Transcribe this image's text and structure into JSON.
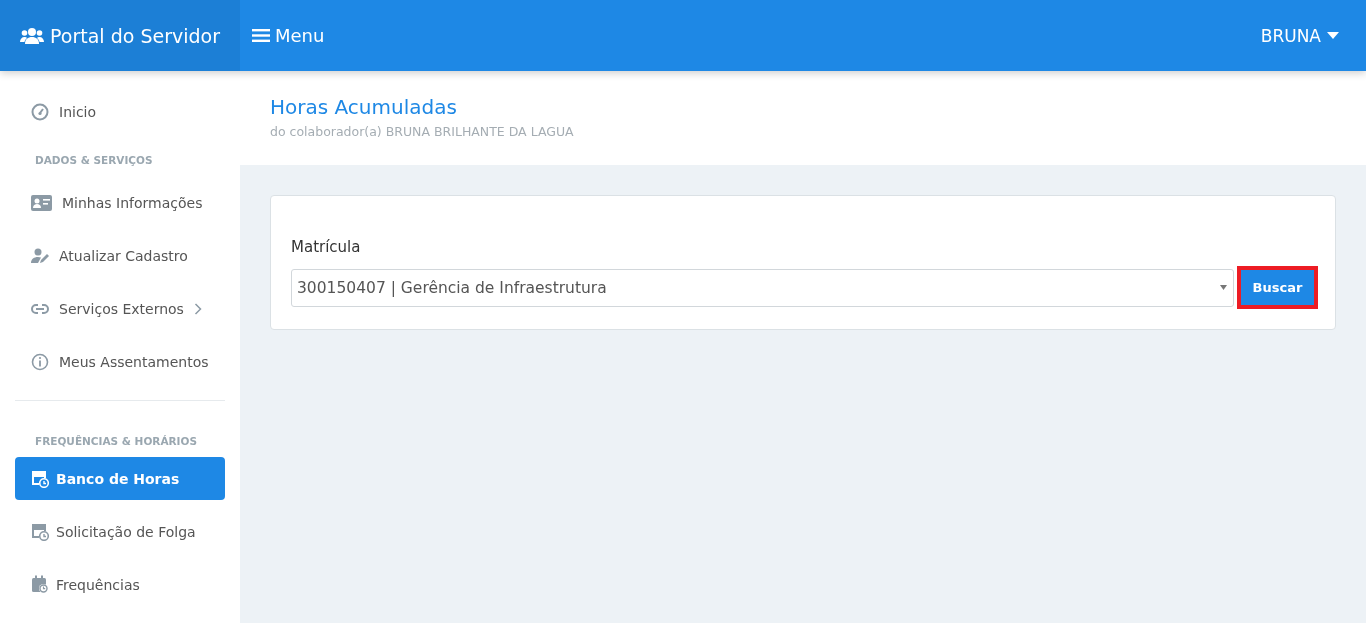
{
  "header": {
    "brand": "Portal do Servidor",
    "menu_label": "Menu",
    "user": "BRUNA"
  },
  "sidebar": {
    "sections": [
      {
        "items": [
          {
            "label": "Inicio",
            "selected": false,
            "has_submenu": false
          }
        ]
      },
      {
        "heading": "DADOS & SERVIÇOS",
        "items": [
          {
            "label": "Minhas Informações",
            "selected": false,
            "has_submenu": false
          },
          {
            "label": "Atualizar Cadastro",
            "selected": false,
            "has_submenu": false
          },
          {
            "label": "Serviços Externos",
            "selected": false,
            "has_submenu": true
          },
          {
            "label": "Meus Assentamentos",
            "selected": false,
            "has_submenu": false
          }
        ]
      },
      {
        "heading": "FREQUÊNCIAS & HORÁRIOS",
        "items": [
          {
            "label": "Banco de Horas",
            "selected": true,
            "has_submenu": false
          },
          {
            "label": "Solicitação de Folga",
            "selected": false,
            "has_submenu": false
          },
          {
            "label": "Frequências",
            "selected": false,
            "has_submenu": false
          }
        ]
      }
    ]
  },
  "page": {
    "title": "Horas Acumuladas",
    "subtitle": "do colaborador(a) BRUNA BRILHANTE DA LAGUA"
  },
  "form": {
    "label": "Matrícula",
    "select_value": "300150407 | Gerência de Infraestrutura",
    "button": {
      "label": "Buscar",
      "highlighted": true
    }
  }
}
